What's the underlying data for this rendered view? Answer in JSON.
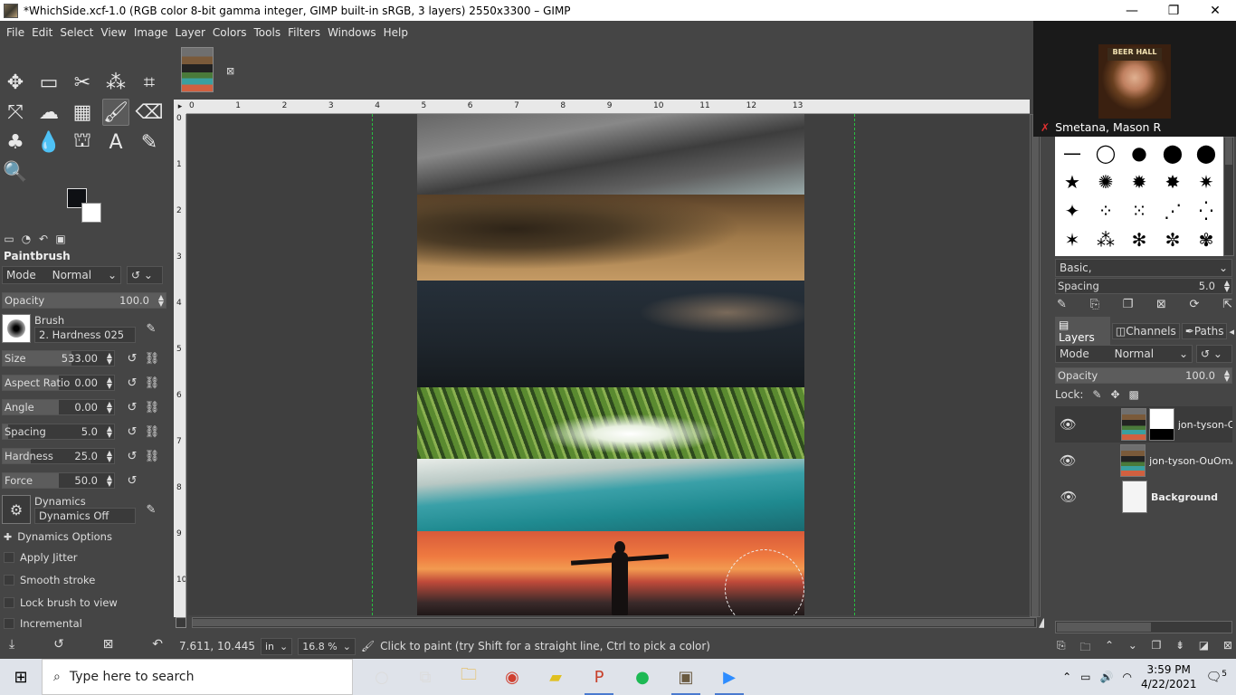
{
  "window": {
    "title": "*WhichSide.xcf-1.0 (RGB color 8-bit gamma integer, GIMP built-in sRGB, 3 layers) 2550x3300 – GIMP",
    "minimize": "—",
    "maximize": "❐",
    "close": "✕"
  },
  "menu": [
    "File",
    "Edit",
    "Select",
    "View",
    "Image",
    "Layer",
    "Colors",
    "Tools",
    "Filters",
    "Windows",
    "Help"
  ],
  "tool_options": {
    "title": "Paintbrush",
    "mode_label": "Mode",
    "mode_value": "Normal",
    "opacity_label": "Opacity",
    "opacity_value": "100.0",
    "opacity_fraction": 1.0,
    "brush_label": "Brush",
    "brush_value": "2. Hardness 025",
    "size_label": "Size",
    "size_value": "533.00",
    "size_fraction": 0.62,
    "aspect_label": "Aspect Ratio",
    "aspect_value": "0.00",
    "aspect_fraction": 0.5,
    "angle_label": "Angle",
    "angle_value": "0.00",
    "angle_fraction": 0.5,
    "spacing_label": "Spacing",
    "spacing_value": "5.0",
    "spacing_fraction": 0.05,
    "hardness_label": "Hardness",
    "hardness_value": "25.0",
    "hardness_fraction": 0.25,
    "force_label": "Force",
    "force_value": "50.0",
    "force_fraction": 0.5,
    "dynamics_label": "Dynamics",
    "dynamics_value": "Dynamics Off",
    "dynamics_options": "Dynamics Options",
    "apply_jitter": "Apply Jitter",
    "smooth_stroke": "Smooth stroke",
    "lock_brush": "Lock brush to view",
    "incremental": "Incremental"
  },
  "ruler_top": [
    "0",
    "1",
    "2",
    "3",
    "4",
    "5",
    "6",
    "7",
    "8",
    "9",
    "10",
    "11",
    "12",
    "13"
  ],
  "ruler_left": [
    "0",
    "1",
    "2",
    "3",
    "4",
    "5",
    "6",
    "7",
    "8",
    "9",
    "10"
  ],
  "status": {
    "coords": "7.611, 10.445",
    "unit": "in",
    "zoom": "16.8 %",
    "hint": "Click to paint (try Shift for a straight line, Ctrl to pick a color)"
  },
  "meeting": {
    "sign": "BEER HALL",
    "participant": "Smetana, Mason R"
  },
  "brushes_panel": {
    "preset": "Basic,",
    "spacing_label": "Spacing",
    "spacing_value": "5.0"
  },
  "layers_panel": {
    "tabs": [
      "Layers",
      "Channels",
      "Paths"
    ],
    "mode_label": "Mode",
    "mode_value": "Normal",
    "opacity_label": "Opacity",
    "opacity_value": "100.0",
    "lock_label": "Lock:",
    "layers": [
      {
        "name": "jon-tyson-C",
        "visible": true
      },
      {
        "name": "jon-tyson-OuOmA",
        "visible": true
      },
      {
        "name": "Background",
        "visible": true
      }
    ]
  },
  "taskbar": {
    "search_placeholder": "Type here to search",
    "time": "3:59 PM",
    "date": "4/22/2021",
    "notifications": "5"
  }
}
